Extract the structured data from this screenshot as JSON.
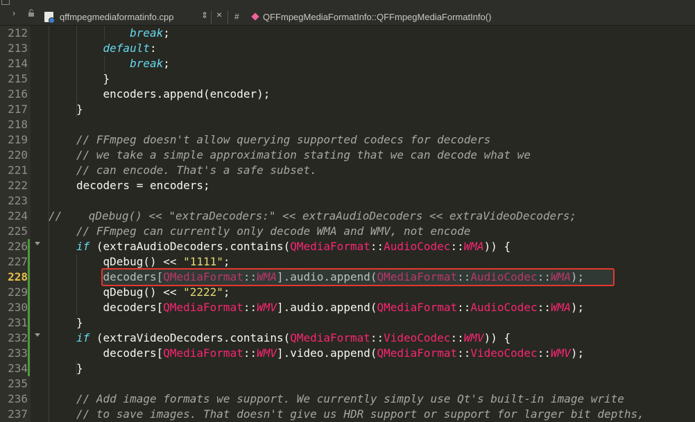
{
  "toolbar": {
    "filename": "qffmpegmediaformatinfo.cpp",
    "hash": "#",
    "function": "QFFmpegMediaFormatInfo::QFFmpegMediaFormatInfo()",
    "icons": [
      "chevron-right-icon",
      "lock-icon",
      "file-cpp-icon",
      "updown-arrows-icon",
      "close-icon",
      "function-diamond-icon"
    ]
  },
  "current_line": 228,
  "lines": [
    {
      "num": "212",
      "tokens": [
        [
          "        ",
          "op"
        ],
        [
          "break",
          "kw"
        ],
        [
          ";",
          "op"
        ]
      ]
    },
    {
      "num": "213",
      "tokens": [
        [
          "    ",
          "op"
        ],
        [
          "default",
          "kw"
        ],
        [
          ":",
          "op"
        ]
      ]
    },
    {
      "num": "214",
      "tokens": [
        [
          "        ",
          "op"
        ],
        [
          "break",
          "kw"
        ],
        [
          ";",
          "op"
        ]
      ]
    },
    {
      "num": "215",
      "tokens": [
        [
          "    }",
          "op"
        ]
      ]
    },
    {
      "num": "216",
      "tokens": [
        [
          "    encoders.append(encoder);",
          "op"
        ]
      ]
    },
    {
      "num": "217",
      "tokens": [
        [
          "}",
          "op"
        ]
      ]
    },
    {
      "num": "218",
      "tokens": []
    },
    {
      "num": "219",
      "tokens": [
        [
          "// FFmpeg doesn't allow querying supported codecs for decoders",
          "cm"
        ]
      ]
    },
    {
      "num": "220",
      "tokens": [
        [
          "// we take a simple approximation stating that we can decode what we",
          "cm"
        ]
      ]
    },
    {
      "num": "221",
      "tokens": [
        [
          "// can encode. That's a safe subset.",
          "cm"
        ]
      ]
    },
    {
      "num": "222",
      "tokens": [
        [
          "decoders = encoders;",
          "op"
        ]
      ]
    },
    {
      "num": "223",
      "tokens": []
    },
    {
      "num": "224",
      "indent": 0,
      "tokens": [
        [
          "//    qDebug() << \"extraDecoders:\" << extraAudioDecoders << extraVideoDecoders;",
          "cm"
        ]
      ]
    },
    {
      "num": "225",
      "tokens": [
        [
          "// FFmpeg can currently only decode WMA and WMV, not encode",
          "cm"
        ]
      ]
    },
    {
      "num": "226",
      "fold": true,
      "tokens": [
        [
          "if",
          "kw"
        ],
        [
          " (extraAudioDecoders.contains(",
          "op"
        ],
        [
          "QMediaFormat",
          "cls"
        ],
        [
          "::",
          "op"
        ],
        [
          "AudioCodec",
          "cls"
        ],
        [
          "::",
          "op"
        ],
        [
          "WMA",
          "en"
        ],
        [
          ")) {",
          "op"
        ]
      ]
    },
    {
      "num": "227",
      "tokens": [
        [
          "    qDebug() << ",
          "op"
        ],
        [
          "\"1111\"",
          "str"
        ],
        [
          ";",
          "op"
        ]
      ]
    },
    {
      "num": "228",
      "tokens": [
        [
          "    decoders[",
          "op"
        ],
        [
          "QMediaFormat",
          "cls"
        ],
        [
          "::",
          "op"
        ],
        [
          "WMA",
          "en"
        ],
        [
          "].audio.append(",
          "op"
        ],
        [
          "QMediaFormat",
          "cls"
        ],
        [
          "::",
          "op"
        ],
        [
          "AudioCodec",
          "cls"
        ],
        [
          "::",
          "op"
        ],
        [
          "WMA",
          "en"
        ],
        [
          ");",
          "op"
        ]
      ]
    },
    {
      "num": "229",
      "tokens": [
        [
          "    qDebug() << ",
          "op"
        ],
        [
          "\"2222\"",
          "str"
        ],
        [
          ";",
          "op"
        ]
      ]
    },
    {
      "num": "230",
      "tokens": [
        [
          "    decoders[",
          "op"
        ],
        [
          "QMediaFormat",
          "cls"
        ],
        [
          "::",
          "op"
        ],
        [
          "WMV",
          "en"
        ],
        [
          "].audio.append(",
          "op"
        ],
        [
          "QMediaFormat",
          "cls"
        ],
        [
          "::",
          "op"
        ],
        [
          "AudioCodec",
          "cls"
        ],
        [
          "::",
          "op"
        ],
        [
          "WMA",
          "en"
        ],
        [
          ");",
          "op"
        ]
      ]
    },
    {
      "num": "231",
      "tokens": [
        [
          "}",
          "op"
        ]
      ]
    },
    {
      "num": "232",
      "fold": true,
      "tokens": [
        [
          "if",
          "kw"
        ],
        [
          " (extraVideoDecoders.contains(",
          "op"
        ],
        [
          "QMediaFormat",
          "cls"
        ],
        [
          "::",
          "op"
        ],
        [
          "VideoCodec",
          "cls"
        ],
        [
          "::",
          "op"
        ],
        [
          "WMV",
          "en"
        ],
        [
          ")) {",
          "op"
        ]
      ]
    },
    {
      "num": "233",
      "tokens": [
        [
          "    decoders[",
          "op"
        ],
        [
          "QMediaFormat",
          "cls"
        ],
        [
          "::",
          "op"
        ],
        [
          "WMV",
          "en"
        ],
        [
          "].video.append(",
          "op"
        ],
        [
          "QMediaFormat",
          "cls"
        ],
        [
          "::",
          "op"
        ],
        [
          "VideoCodec",
          "cls"
        ],
        [
          "::",
          "op"
        ],
        [
          "WMV",
          "en"
        ],
        [
          ");",
          "op"
        ]
      ]
    },
    {
      "num": "234",
      "tokens": [
        [
          "}",
          "op"
        ]
      ]
    },
    {
      "num": "235",
      "tokens": []
    },
    {
      "num": "236",
      "tokens": [
        [
          "// Add image formats we support. We currently simply use Qt's built-in image write",
          "cm"
        ]
      ]
    },
    {
      "num": "237",
      "tokens": [
        [
          "// to save images. That doesn't give us HDR support or support for larger bit depths,",
          "cm"
        ]
      ]
    }
  ],
  "colors": {
    "background": "#272822",
    "highlight_border": "#e8372e",
    "current_line_number": "#e8c14a"
  }
}
